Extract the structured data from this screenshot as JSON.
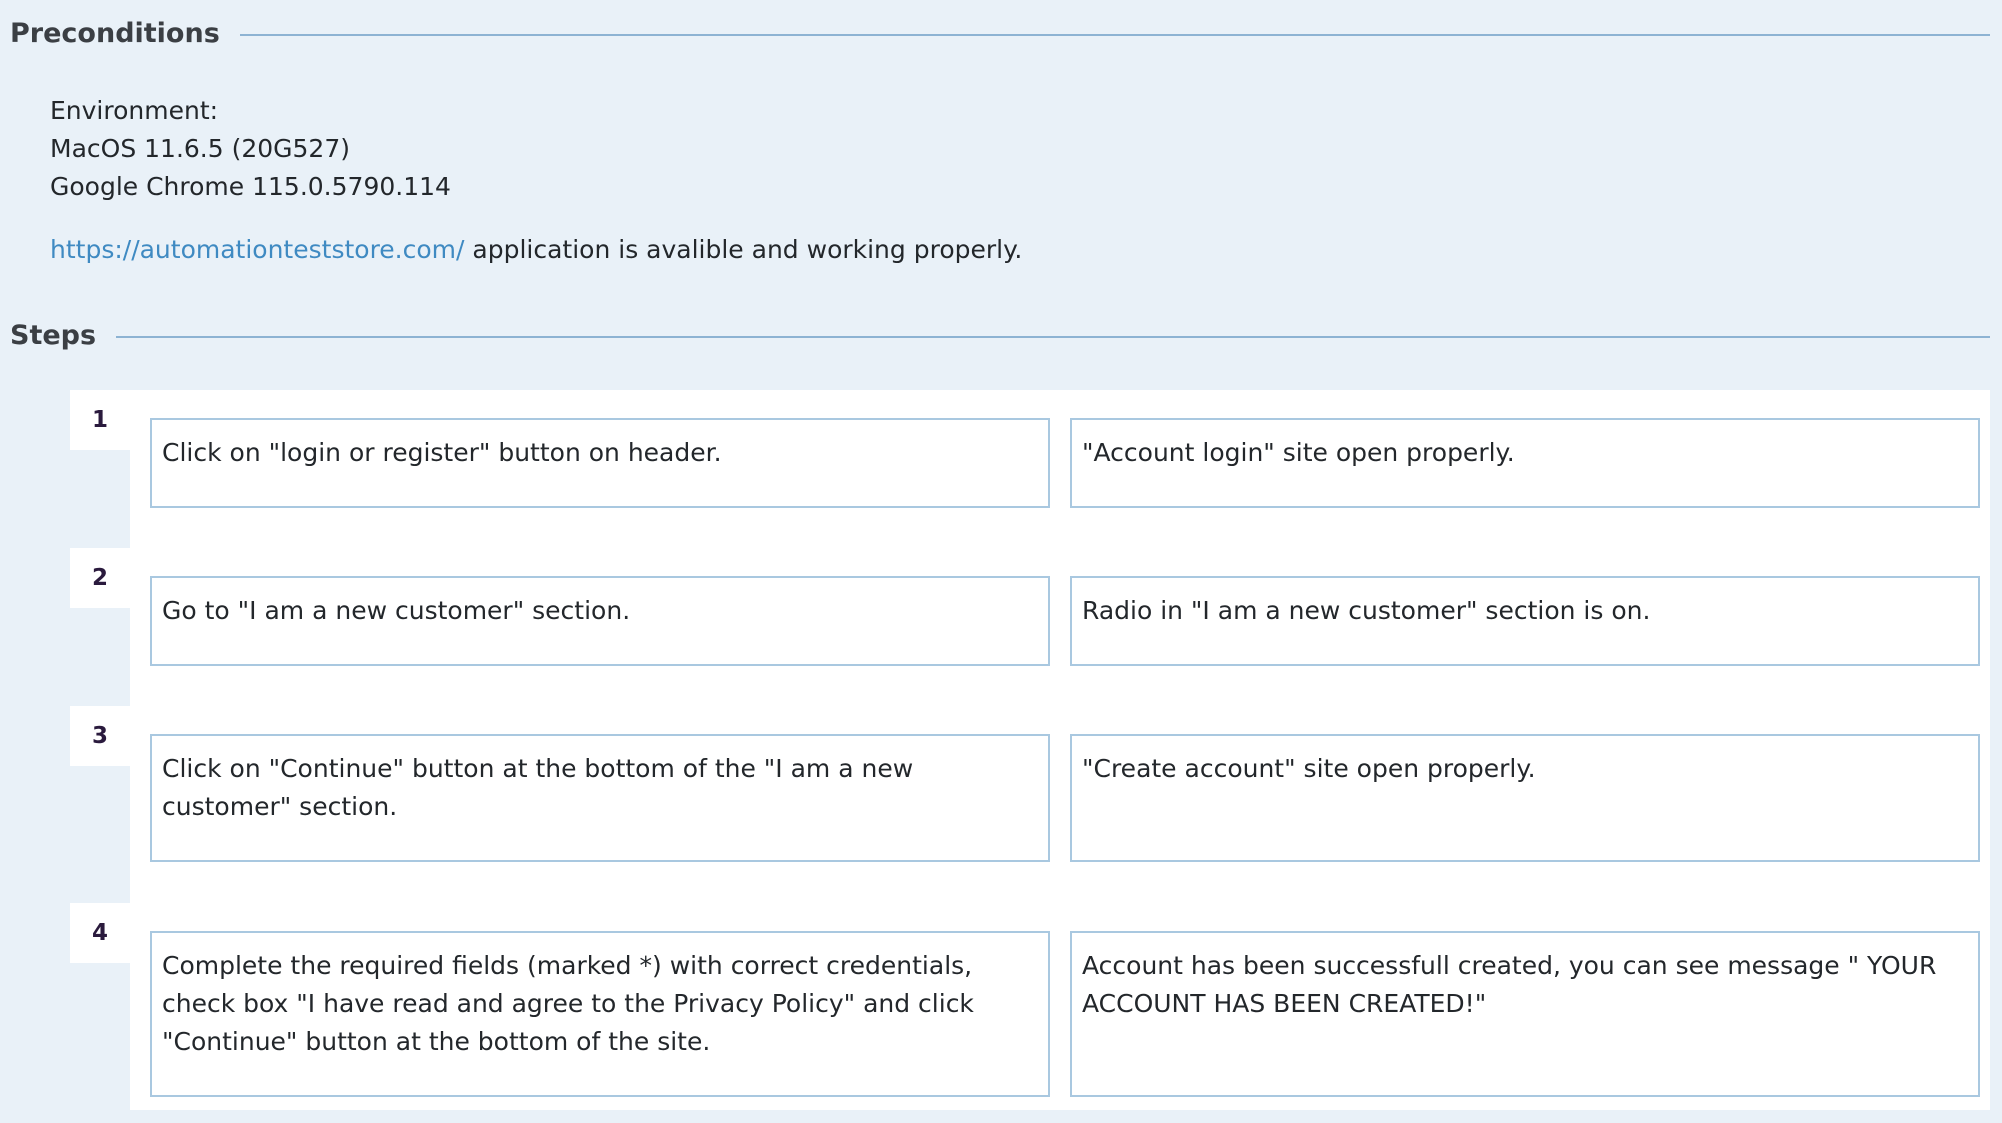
{
  "preconditions": {
    "title": "Preconditions",
    "environment_label": "Environment:",
    "os": "MacOS 11.6.5 (20G527)",
    "browser": "Google Chrome 115.0.5790.114",
    "link_text": "https://automationteststore.com/",
    "link_suffix": " application is avalible and working properly."
  },
  "steps": {
    "title": "Steps",
    "items": [
      {
        "number": "1",
        "action": "Click on \"login or register\" button on header.",
        "result": "\"Account login\" site open properly."
      },
      {
        "number": "2",
        "action": "Go to \"I am a new customer\" section.",
        "result": "Radio in \"I am a new customer\" section is on."
      },
      {
        "number": "3",
        "action": "Click on \"Continue\" button at the bottom of the \"I am a new customer\" section.",
        "result": "\"Create account\" site open properly."
      },
      {
        "number": "4",
        "action": "Complete the required fields (marked *) with correct credentials, check box \"I have read and agree to the Privacy Policy\" and click \"Continue\" button at the bottom of the site.",
        "result": "Account has been successfull created, you can see message \" YOUR ACCOUNT HAS BEEN CREATED!\""
      }
    ]
  },
  "colors": {
    "background": "#e9f1f8",
    "link": "#3f8ac2",
    "rule": "#8db3d3",
    "cell_border": "#a9c8e0"
  }
}
